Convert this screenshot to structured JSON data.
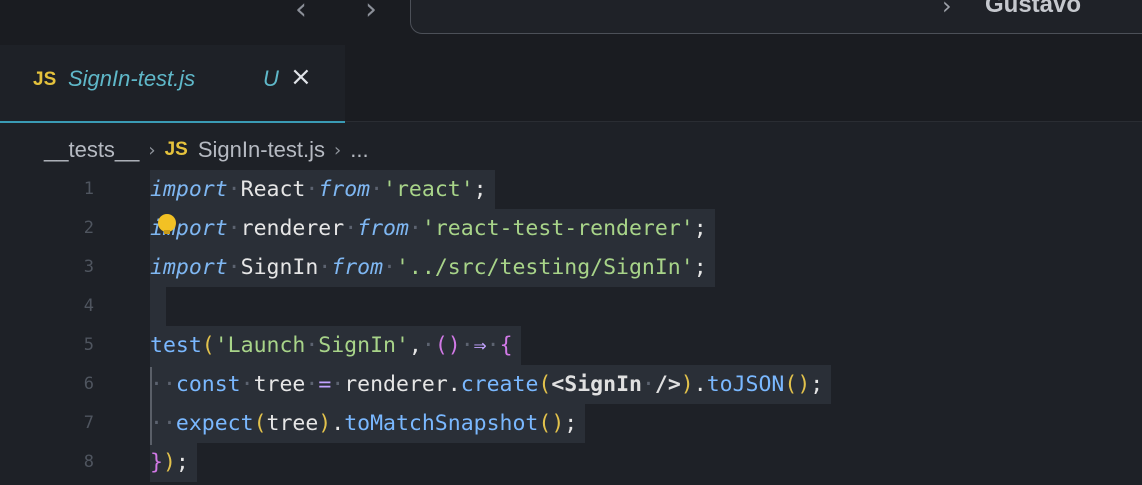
{
  "topbar": {
    "back_arrow": "‹",
    "forward_arrow": "›",
    "command_center_text": "Gustavo",
    "chevron": "›"
  },
  "tab": {
    "badge": "JS",
    "title": "SignIn-test.js",
    "modified": "U",
    "close": "×"
  },
  "breadcrumb": {
    "folder": "__tests__",
    "badge": "JS",
    "file": "SignIn-test.js",
    "more": "..."
  },
  "code": {
    "line_numbers": [
      "1",
      "2",
      "3",
      "4",
      "5",
      "6",
      "7",
      "8"
    ],
    "lines": [
      "import React from 'react';",
      "import renderer from 'react-test-renderer';",
      "import SignIn from '../src/testing/SignIn';",
      "",
      "test('Launch SignIn', () => {",
      "  const tree = renderer.create(<SignIn />).toJSON();",
      "  expect(tree).toMatchSnapshot();",
      "});"
    ]
  },
  "colors": {
    "background": "#1e2127",
    "tab_accent": "#3a9bb5",
    "js_badge": "#e5c23c",
    "lightbulb": "#f2c124"
  },
  "icons": [
    "back-arrow-icon",
    "forward-arrow-icon",
    "close-icon",
    "lightbulb-icon"
  ]
}
